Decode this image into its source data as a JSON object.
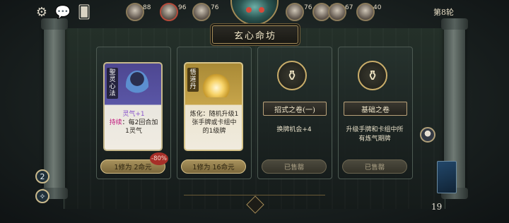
{
  "topbar": {
    "icons": [
      "gear-icon",
      "chat-icon",
      "cards-icon"
    ],
    "players": [
      {
        "hp": "88"
      },
      {
        "hp": "96"
      },
      {
        "hp": "76"
      },
      {
        "hp": "76"
      },
      {
        "hp": "71"
      },
      {
        "hp": "72"
      },
      {
        "hp": "67"
      },
      {
        "hp": "40"
      }
    ],
    "round_label": "第8轮"
  },
  "shop": {
    "title": "玄心命坊",
    "slots": [
      {
        "kind": "card",
        "card_name": "聖灵心法",
        "desc_line1": "灵气+1",
        "desc_hl": "持续",
        "desc_rest": "：每2回合加1灵气",
        "price": "1修为  2命元",
        "discount": "-80%"
      },
      {
        "kind": "card",
        "card_name": "悟道丹",
        "desc": "炼化：随机升级1张手牌或卡组中的1级牌",
        "price": "1修为  16命元"
      },
      {
        "kind": "item",
        "icon": "scroll-bottle-icon",
        "name": "招式之卷(一)",
        "desc": "换牌机会+4",
        "status": "已售罄"
      },
      {
        "kind": "item",
        "icon": "scroll-bottle-icon",
        "name": "基础之卷",
        "desc": "升级手牌和卡组中所有炼气期牌",
        "status": "已售罄"
      }
    ]
  },
  "hud": {
    "orb_value": "2",
    "deck_count": "19"
  },
  "colors": {
    "accent_gold": "#c9ad6a",
    "purple_card": "#4e4791",
    "sold_out": "#353329",
    "discount_red": "#a72f28"
  }
}
